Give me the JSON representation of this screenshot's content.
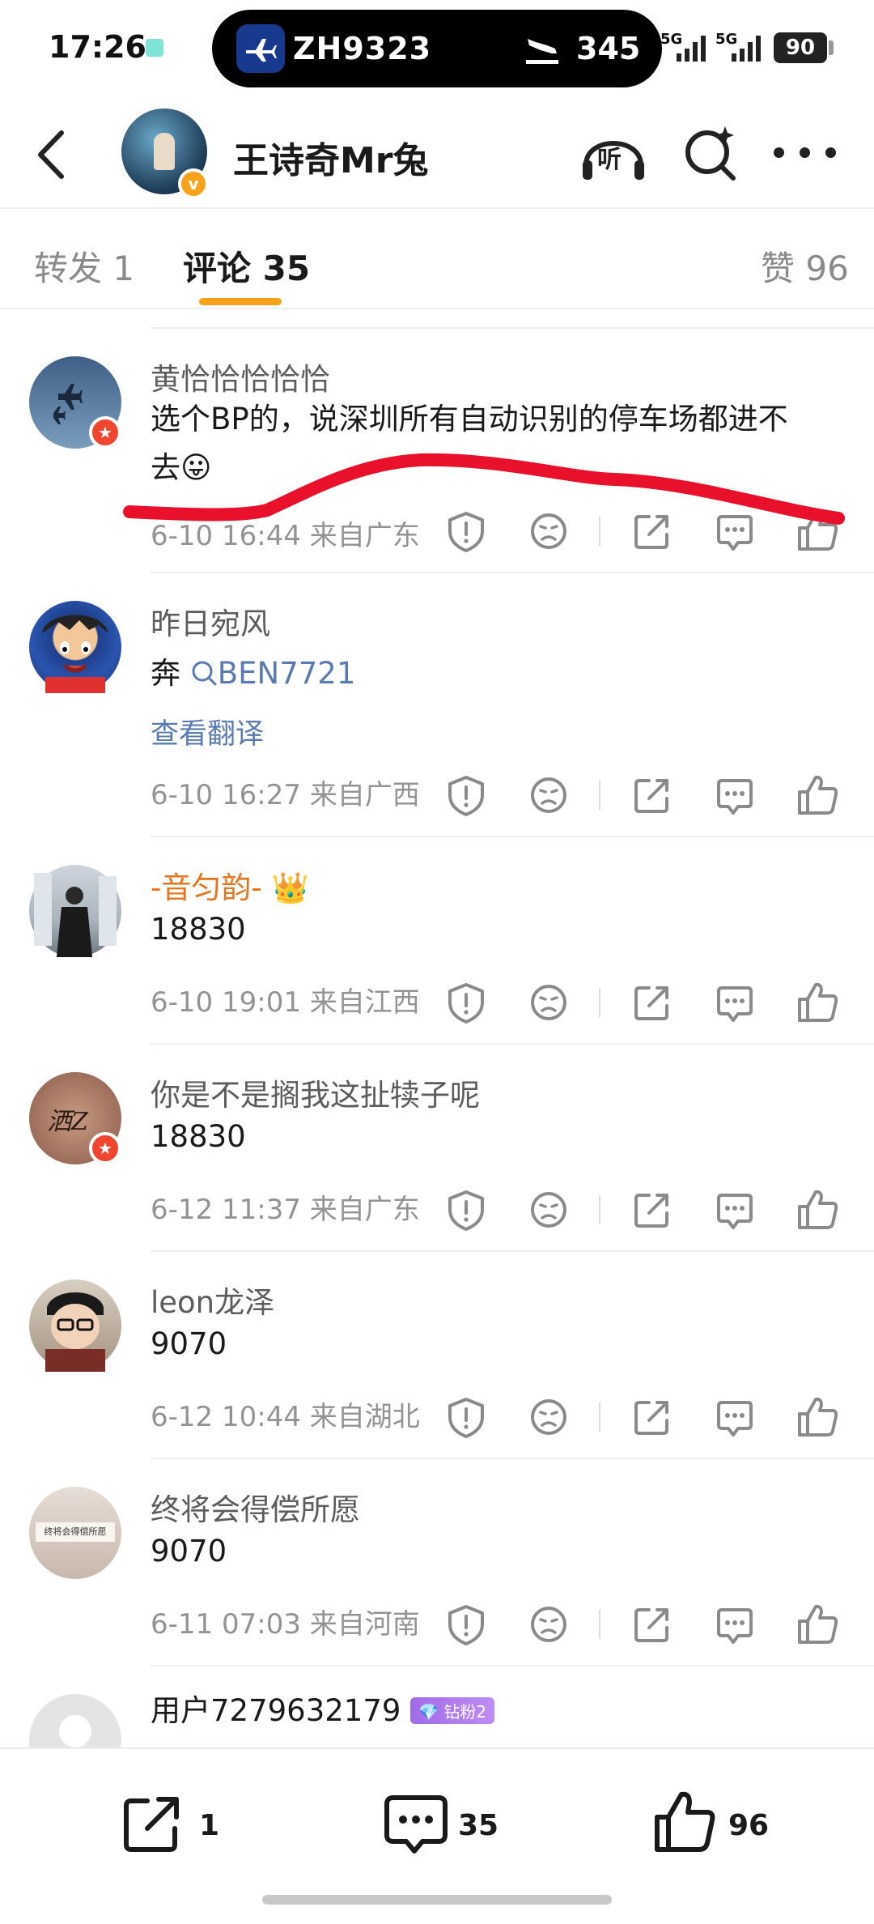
{
  "status_bar": {
    "time": "17:26",
    "flight": "ZH9323",
    "count": "345",
    "signal1": "5G",
    "signal2": "5G",
    "battery": "90"
  },
  "header": {
    "title": "王诗奇Mr兔",
    "listen_label": "听",
    "verified_badge": "v"
  },
  "tabs": {
    "repost": "转发 1",
    "comments": "评论 35",
    "likes": "赞 96"
  },
  "comments": [
    {
      "name": "黄恰恰恰恰恰",
      "text_line1": "选个BP的，说深圳所有自动识别的停车场都进不",
      "text_line2": "去",
      "emoji": "😛",
      "meta": "6-10 16:44  来自广东"
    },
    {
      "name": "昨日宛风",
      "text_prefix": "奔 ",
      "search_link": "BEN7721",
      "translate": "查看翻译",
      "meta": "6-10 16:27  来自广西"
    },
    {
      "name": "-音匀韵-",
      "crown": "👑",
      "text": "18830",
      "meta": "6-10 19:01  来自江西"
    },
    {
      "name": "你是不是搁我这扯犊子呢",
      "text": "18830",
      "meta": "6-12 11:37  来自广东",
      "avatar_text": "洒Z"
    },
    {
      "name": "leon龙泽",
      "text": "9070",
      "meta": "6-12 10:44  来自湖北"
    },
    {
      "name": "终将会得偿所愿",
      "text": "9070",
      "meta": "6-11 07:03  来自河南",
      "avatar_text": "终将会得偿所愿"
    },
    {
      "name": "用户7279632179",
      "fan_badge": "钻粉2"
    }
  ],
  "bottom_bar": {
    "repost_count": "1",
    "comment_count": "35",
    "like_count": "96"
  },
  "colors": {
    "accent": "#f7a21b",
    "link": "#5a7bb0",
    "annotation_red": "#e8102a"
  }
}
